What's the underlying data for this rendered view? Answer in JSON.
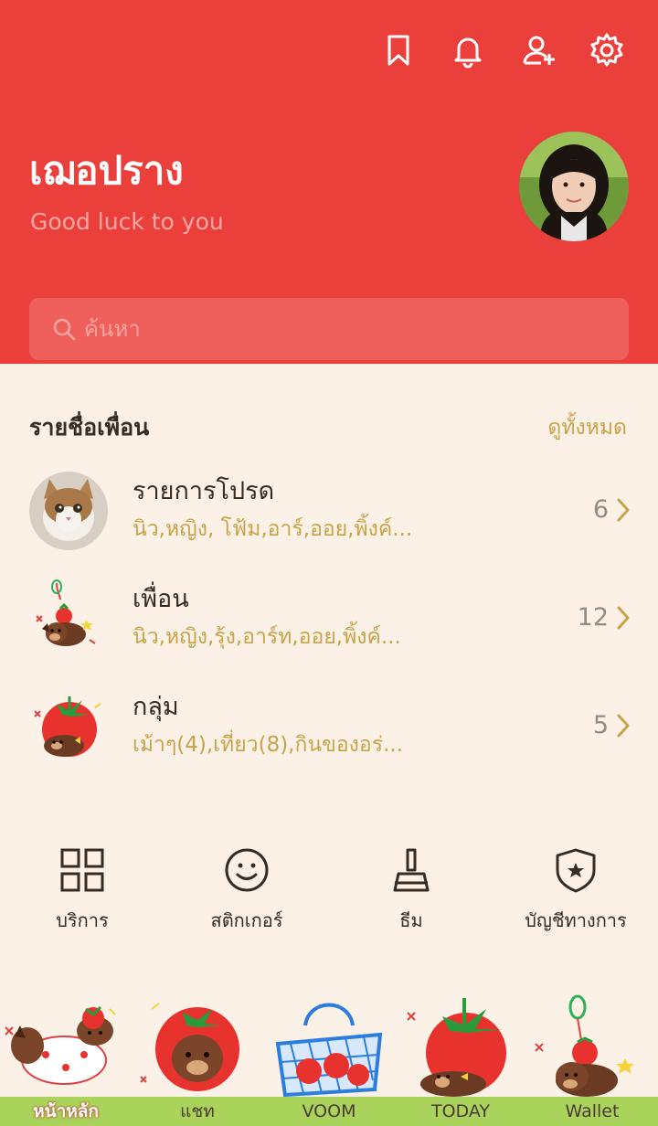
{
  "header": {
    "profile_name": "เฌอปราง",
    "status_message": "Good luck to you",
    "icons": [
      "bookmark-icon",
      "bell-icon",
      "add-friend-icon",
      "gear-icon"
    ]
  },
  "search": {
    "placeholder": "ค้นหา"
  },
  "friends_section": {
    "title": "รายชื่อเพื่อน",
    "see_all": "ดูทั้งหมด",
    "rows": [
      {
        "title": "รายการโปรด",
        "subtitle": "นิว,หญิง, โฟ้ม,อาร์,ออย,พิ้งค์...",
        "count": "6"
      },
      {
        "title": "เพื่อน",
        "subtitle": "นิว,หญิง,รุ้ง,อาร์ท,ออย,พิ้งค์...",
        "count": "12"
      },
      {
        "title": "กลุ่ม",
        "subtitle": "เม้าๆ(4),เที่ยว(8),กินของอร่...",
        "count": "5"
      }
    ]
  },
  "quick_actions": [
    {
      "label": "บริการ",
      "icon": "grid-icon"
    },
    {
      "label": "สติกเกอร์",
      "icon": "smiley-icon"
    },
    {
      "label": "ธีม",
      "icon": "brush-icon"
    },
    {
      "label": "บัญชีทางการ",
      "icon": "shield-star-icon"
    }
  ],
  "tabs": [
    {
      "label": "หน้าหลัก",
      "active": true
    },
    {
      "label": "แชท",
      "active": false
    },
    {
      "label": "VOOM",
      "active": false
    },
    {
      "label": "TODAY",
      "active": false
    },
    {
      "label": "Wallet",
      "active": false
    }
  ],
  "colors": {
    "header_red": "#eb3f3b",
    "background_cream": "#fbf1e6",
    "accent_gold": "#c9a34a",
    "text_brown": "#3a2a24"
  }
}
